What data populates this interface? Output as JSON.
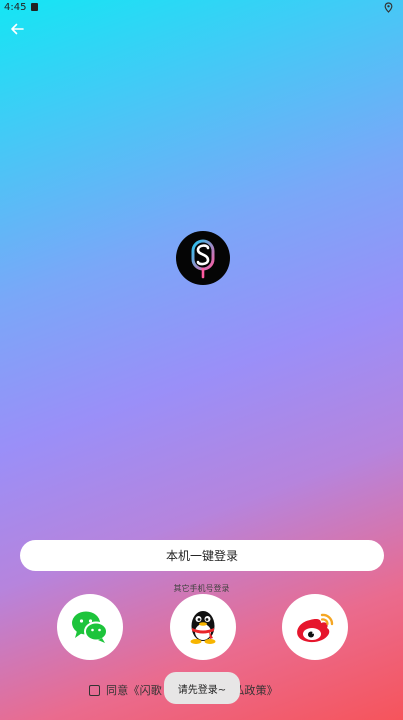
{
  "status_bar": {
    "time": "4:45",
    "notification_icon": "notification-icon",
    "location_icon": "location-icon"
  },
  "header": {
    "back_icon": "arrow-left-icon"
  },
  "logo": {
    "icon": "app-logo-icon",
    "colors": [
      "#1ec8f5",
      "#ff5aa0"
    ]
  },
  "login": {
    "one_key_label": "本机一键登录",
    "other_phone_label": "其它手机号登录"
  },
  "social": [
    {
      "name": "wechat",
      "icon": "wechat-icon",
      "color": "#1dc43b"
    },
    {
      "name": "qq",
      "icon": "qq-icon"
    },
    {
      "name": "weibo",
      "icon": "weibo-icon",
      "color": "#e6162d"
    }
  ],
  "agreement": {
    "text": "同意《闪歌",
    "text_tail": "隐私政策》"
  },
  "toast": {
    "text": "请先登录~"
  }
}
